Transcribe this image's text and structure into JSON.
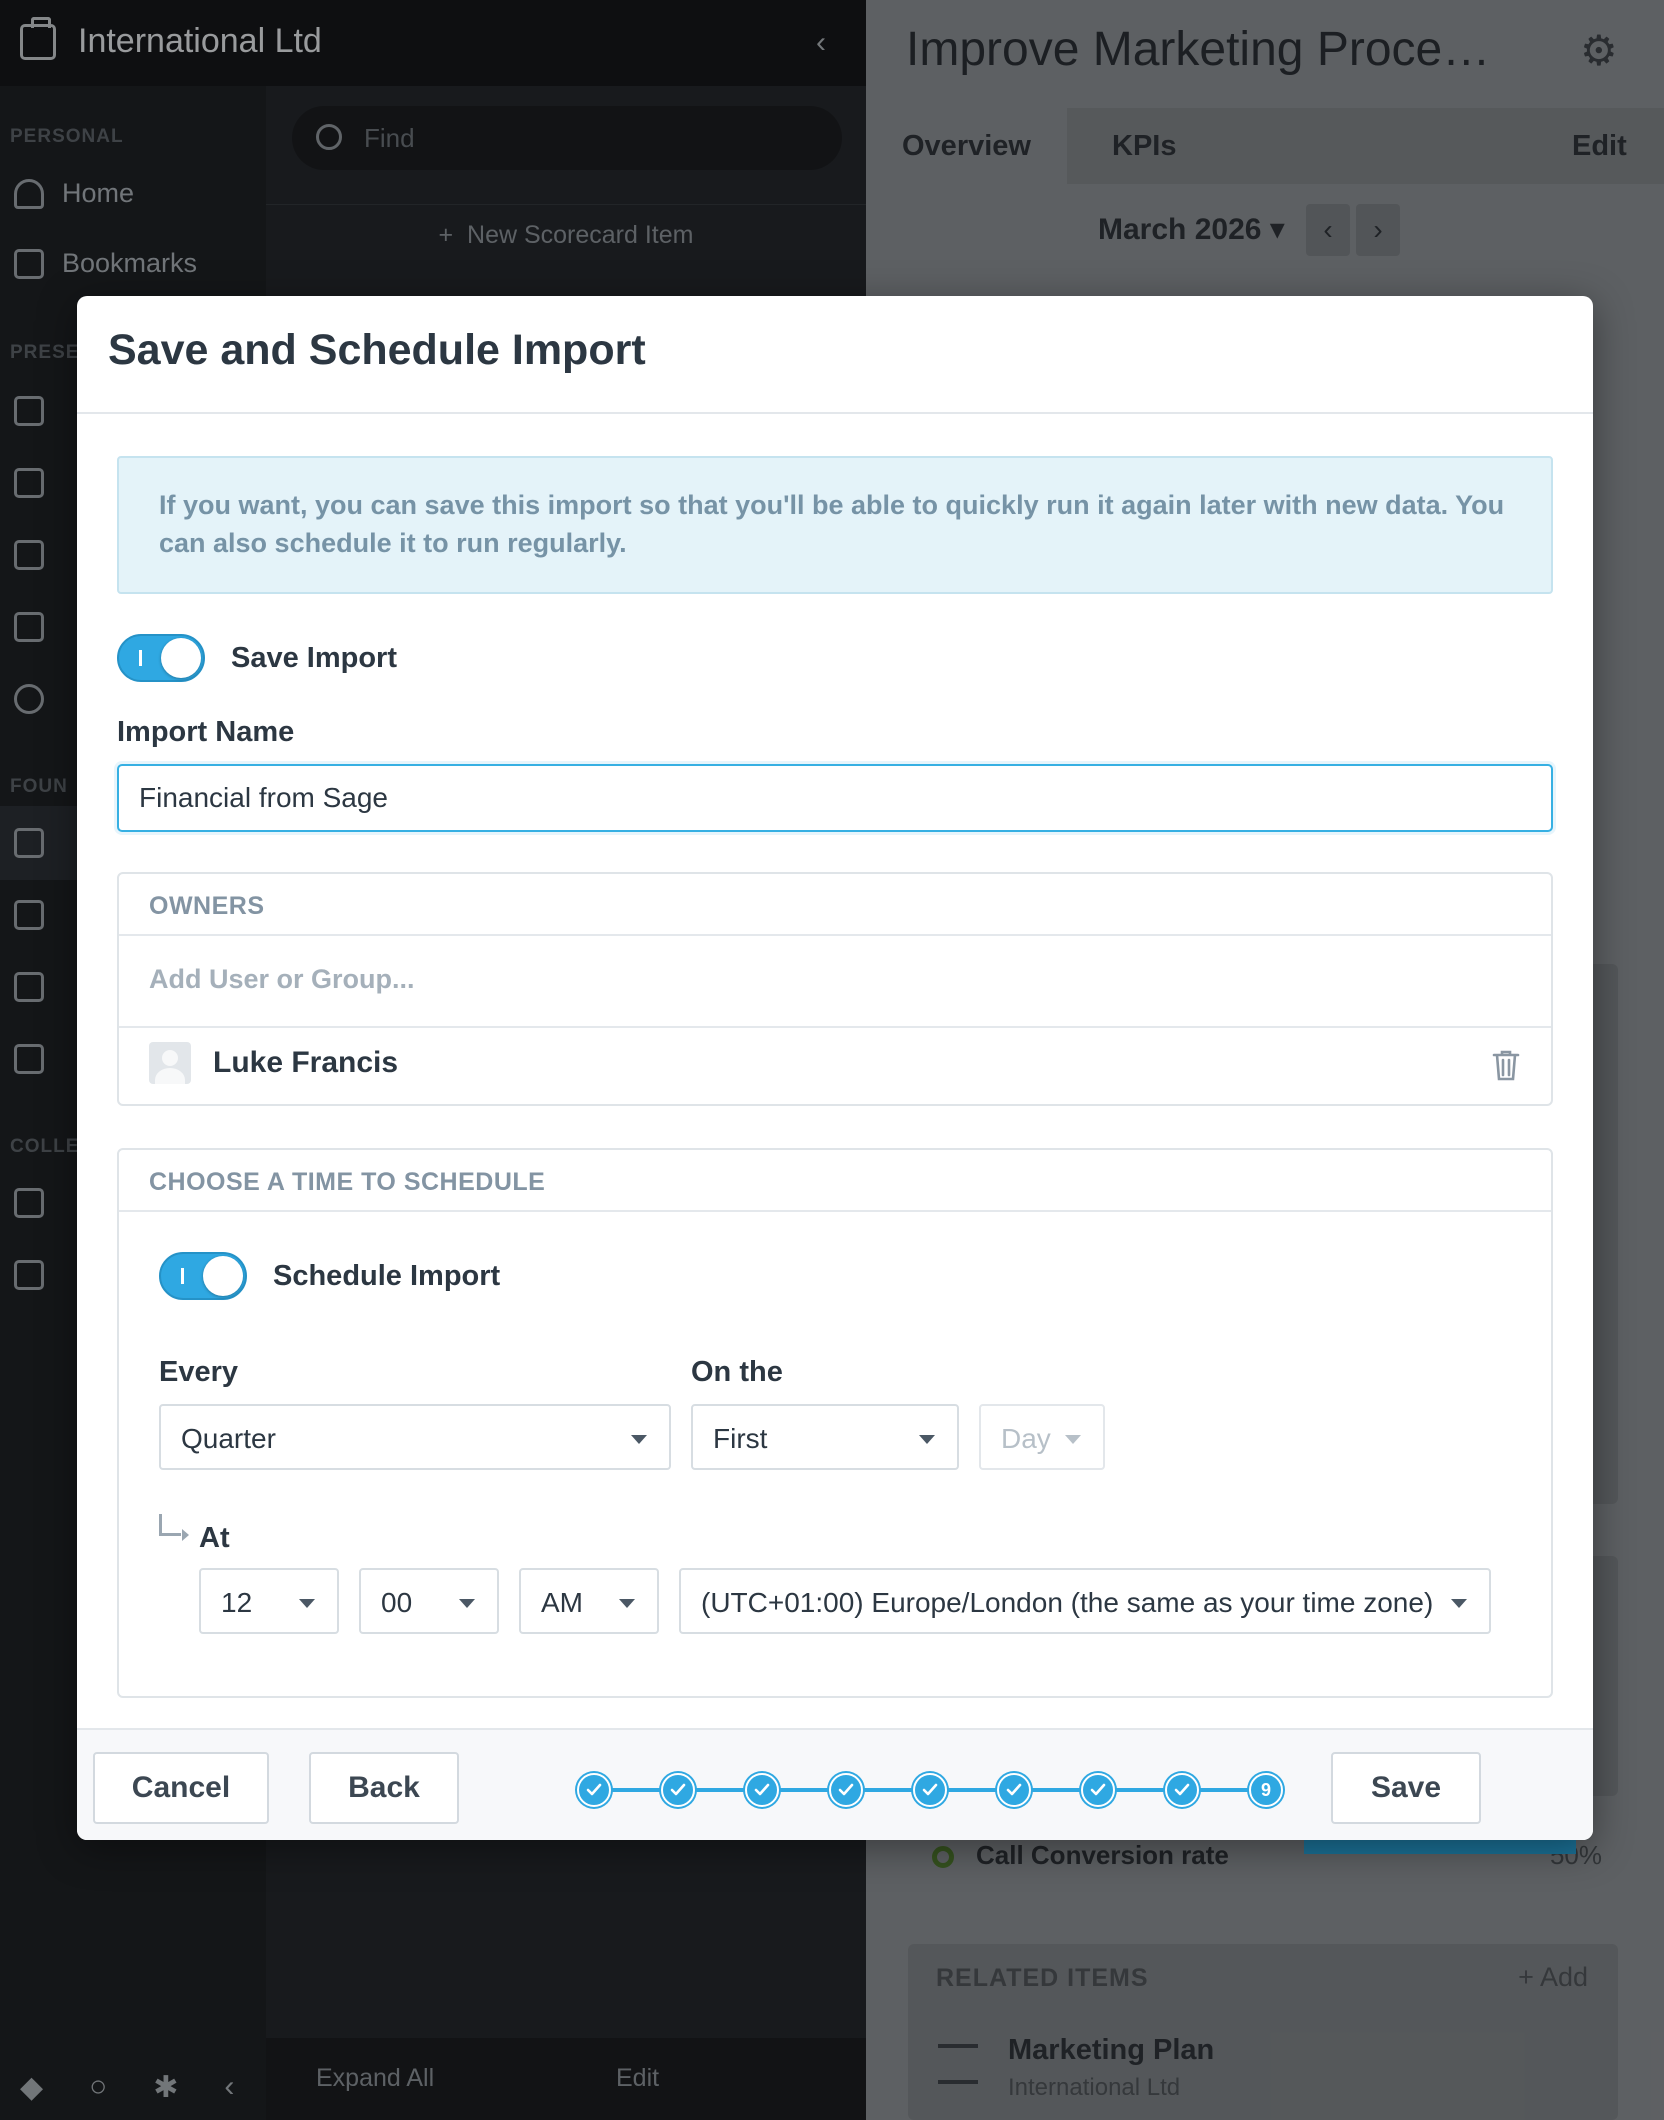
{
  "background": {
    "org_name": "International Ltd",
    "find_placeholder": "Find",
    "new_item": "New Scorecard Item",
    "sections": {
      "personal": "PERSONAL",
      "present": "PRESE",
      "found": "FOUN",
      "collect": "COLLE"
    },
    "nav": {
      "home": "Home",
      "bookmarks": "Bookmarks"
    },
    "footer": {
      "expand": "Expand All",
      "edit": "Edit"
    },
    "right": {
      "title": "Improve Marketing Proce…",
      "tabs": [
        "Overview",
        "KPIs",
        "Edit"
      ],
      "period": "March 2026",
      "kpi_name": "Call Conversion rate",
      "kpi_value": "50%",
      "related_header": "RELATED ITEMS",
      "related_add": "Add",
      "related_item": "Marketing Plan",
      "related_sub": "International Ltd"
    }
  },
  "modal": {
    "title": "Save and Schedule Import",
    "info": "If you want, you can save this import so that you'll be able to quickly run it again later with new data. You can also schedule it to run regularly.",
    "save_import_label": "Save Import",
    "save_import_on": true,
    "import_name_label": "Import Name",
    "import_name_value": "Financial from Sage",
    "owners_header": "OWNERS",
    "add_user_placeholder": "Add User or Group...",
    "owner_name": "Luke Francis",
    "schedule_header": "CHOOSE A TIME TO SCHEDULE",
    "schedule_import_label": "Schedule Import",
    "schedule_import_on": true,
    "every_label": "Every",
    "every_value": "Quarter",
    "on_the_label": "On the",
    "on_the_value": "First",
    "day_value": "Day",
    "at_label": "At",
    "hour": "12",
    "minute": "00",
    "ampm": "AM",
    "timezone": "(UTC+01:00) Europe/London (the same as your time zone)"
  },
  "footer": {
    "cancel": "Cancel",
    "back": "Back",
    "save": "Save",
    "steps_total": 9,
    "current_step": 9,
    "current_step_label": "9"
  },
  "colors": {
    "accent": "#2fa8e2",
    "info_bg": "#e4f3f9",
    "text": "#2c3742"
  }
}
